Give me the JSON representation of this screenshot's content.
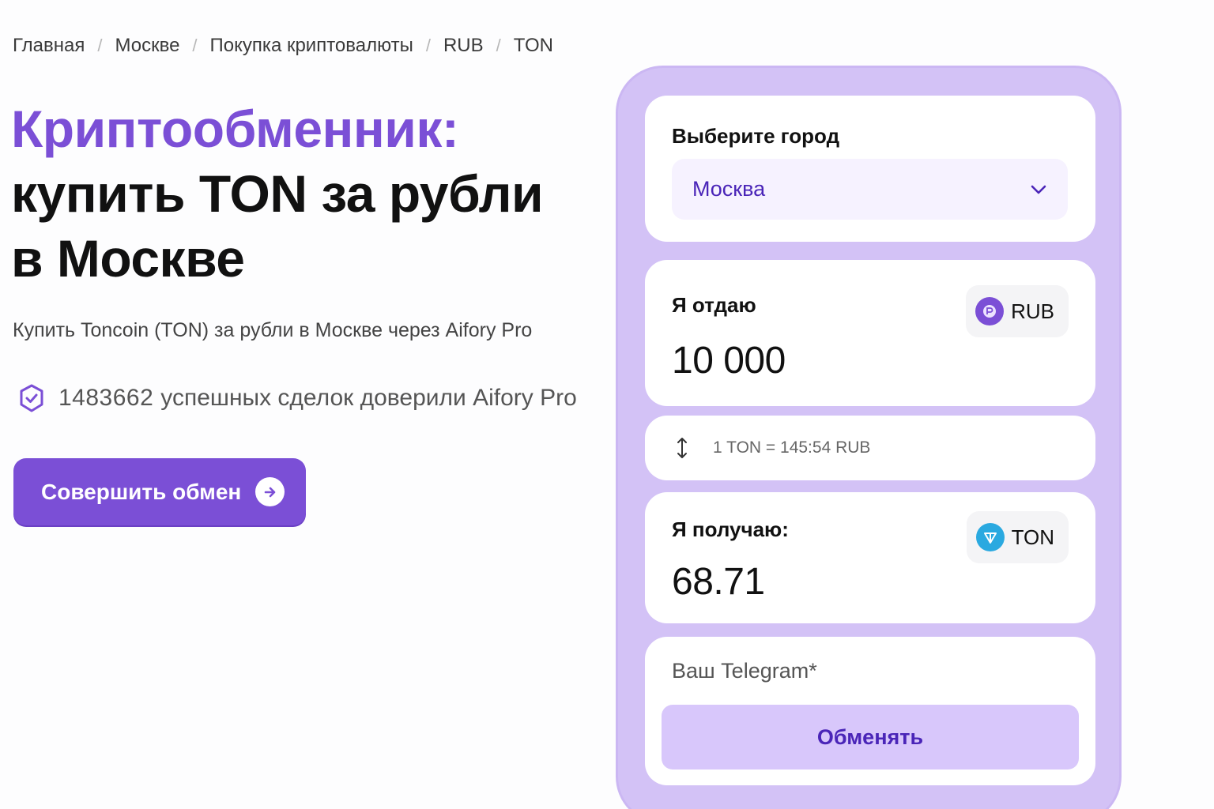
{
  "breadcrumb": [
    "Главная",
    "Москве",
    "Покупка криптовалюты",
    "RUB",
    "TON"
  ],
  "hero": {
    "title_accent": "Криптообменник:",
    "title_line1": "купить TON за рубли",
    "title_line2": "в Москве",
    "subtitle": "Купить Toncoin (TON) за рубли в Москве через Aifory Pro",
    "trust_count": "1483662",
    "trust_text": "успешных сделок доверили Aifory Pro",
    "cta_label": "Совершить обмен"
  },
  "widget": {
    "city_label": "Выберите город",
    "city_value": "Москва",
    "give_label": "Я отдаю",
    "give_amount": "10 000",
    "give_currency": "RUB",
    "rate_text": "1 TON = 145:54 RUB",
    "get_label": "Я получаю:",
    "get_amount": "68.71",
    "get_currency": "TON",
    "telegram_placeholder": "Ваш Telegram*",
    "submit_label": "Обменять"
  },
  "icons": {
    "shield": "shield-check-icon",
    "arrow": "arrow-right-icon",
    "chevron": "chevron-down-icon",
    "swap": "swap-vertical-icon",
    "rub_coin": "rub-coin-icon",
    "ton_coin": "ton-coin-icon"
  },
  "colors": {
    "accent": "#7b4fd6",
    "widget_bg": "#d3c2f6",
    "button_light": "#d8c7fb",
    "ton_blue": "#2aa9e0"
  }
}
